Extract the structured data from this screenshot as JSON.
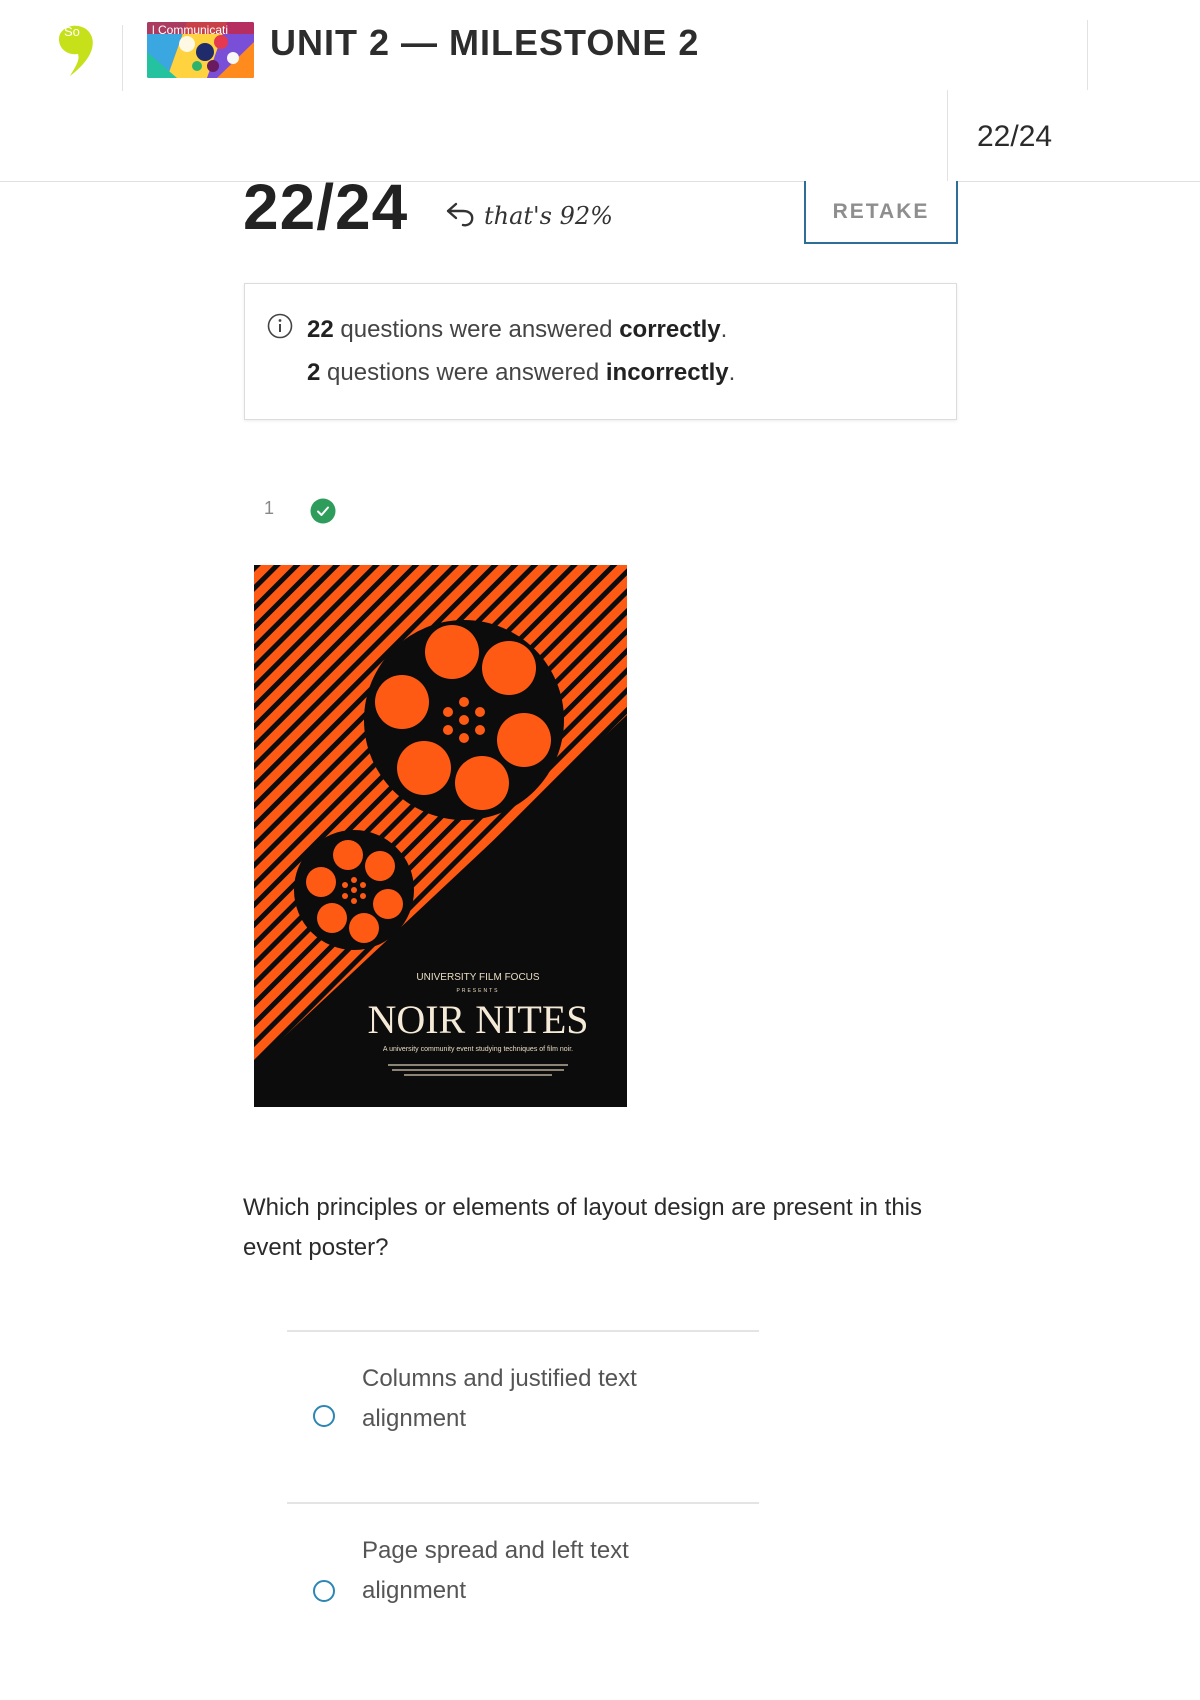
{
  "header": {
    "logo_text": "So",
    "course_thumb_label": "l Communicati",
    "unit_title": "UNIT 2 — MILESTONE 2",
    "score_tab": "22/24"
  },
  "score": {
    "value": "22/24",
    "percent_note": "that's 92%",
    "retake_label": "RETAKE"
  },
  "summary": {
    "correct_count": "22",
    "correct_text": "questions were answered",
    "correct_word": "correctly",
    "incorrect_count": "2",
    "incorrect_text": "questions were answered",
    "incorrect_word": "incorrectly",
    "period": "."
  },
  "question": {
    "number": "1",
    "status": "correct",
    "prompt": "Which principles or elements of layout design are present in this event poster?",
    "options": [
      {
        "label": "Columns and justified text alignment",
        "selected": false
      },
      {
        "label": "Page spread and left text alignment",
        "selected": false
      }
    ]
  },
  "poster": {
    "kicker": "UNIVERSITY FILM FOCUS",
    "presents": "PRESENTS",
    "title": "NOIR NITES",
    "tagline": "A university community event studying techniques of film noir."
  },
  "colors": {
    "accent_blue": "#2d6d96",
    "radio_blue": "#2d86b3",
    "success_green": "#2e9d5b",
    "poster_orange": "#ff5a14",
    "poster_black": "#0c0c0c",
    "logo_lime": "#c6e01a"
  },
  "icons": {
    "logo": "sophia-logo-icon",
    "return": "return-arrow-icon",
    "info": "info-icon",
    "check": "check-circle-icon"
  }
}
